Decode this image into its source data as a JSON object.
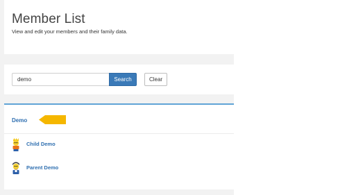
{
  "header": {
    "title": "Member List",
    "subtitle": "View and edit your members and their family data."
  },
  "search": {
    "value": "demo",
    "button_label": "Search",
    "clear_label": "Clear"
  },
  "results": {
    "family_name": "Demo",
    "members": [
      {
        "name": "Child Demo",
        "avatar": "child-avatar-icon"
      },
      {
        "name": "Parent Demo",
        "avatar": "parent-avatar-icon"
      }
    ]
  },
  "colors": {
    "primary": "#3a7ab8",
    "link": "#2f6fb0",
    "accent_border": "#5fa3d6",
    "arrow": "#f5b700",
    "background": "#f2f2f2"
  }
}
